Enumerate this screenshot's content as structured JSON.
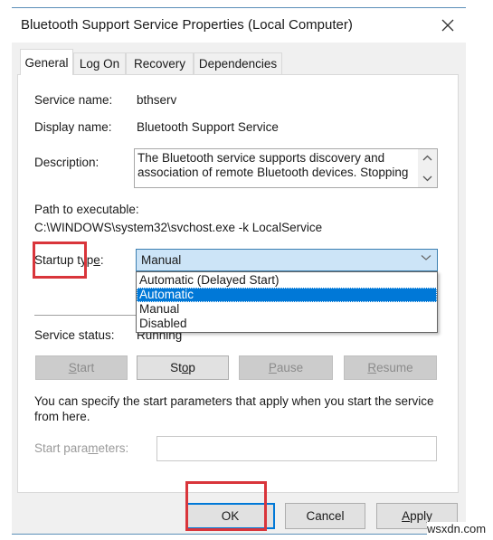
{
  "window": {
    "title": "Bluetooth Support Service Properties (Local Computer)",
    "close_icon": "close-x-icon"
  },
  "tabs": [
    {
      "label": "General",
      "active": true
    },
    {
      "label": "Log On",
      "active": false
    },
    {
      "label": "Recovery",
      "active": false
    },
    {
      "label": "Dependencies",
      "active": false
    }
  ],
  "general": {
    "service_name_label": "Service name:",
    "service_name_value": "bthserv",
    "display_name_label": "Display name:",
    "display_name_value": "Bluetooth Support Service",
    "description_label": "Description:",
    "description_value": "The Bluetooth service supports discovery and association of remote Bluetooth devices.  Stopping",
    "path_label": "Path to executable:",
    "path_value": "C:\\WINDOWS\\system32\\svchost.exe -k LocalService",
    "startup_type_label_pre": "Startup typ",
    "startup_type_label_accel": "e",
    "startup_type_label_post": ":",
    "startup_type_selected": "Manual",
    "startup_type_options": [
      {
        "label": "Automatic (Delayed Start)",
        "highlighted": false
      },
      {
        "label": "Automatic",
        "highlighted": true
      },
      {
        "label": "Manual",
        "highlighted": false
      },
      {
        "label": "Disabled",
        "highlighted": false
      }
    ],
    "service_status_label": "Service status:",
    "service_status_value": "Running",
    "control_buttons": {
      "start": {
        "accel": "S",
        "rest": "tart",
        "enabled": false
      },
      "stop": {
        "pre": "St",
        "accel": "o",
        "rest": "p",
        "enabled": true
      },
      "pause": {
        "accel": "P",
        "rest": "ause",
        "enabled": false
      },
      "resume": {
        "accel": "R",
        "rest": "esume",
        "enabled": false
      }
    },
    "start_params_help": "You can specify the start parameters that apply when you start the service from here.",
    "start_params_label_pre": "Start para",
    "start_params_label_accel": "m",
    "start_params_label_post": "eters:",
    "start_params_value": ""
  },
  "footer": {
    "ok_label": "OK",
    "cancel_label": "Cancel",
    "apply_accel": "A",
    "apply_rest": "pply"
  },
  "annotations": {
    "highlight_color": "#d9353b",
    "highlighted_targets": [
      "startup-type-label",
      "ok-button"
    ]
  },
  "watermark": "wsxdn.com",
  "colors": {
    "select_bg": "#cce4f7",
    "selection_blue": "#0078d7",
    "window_border": "#5b8fb8"
  }
}
